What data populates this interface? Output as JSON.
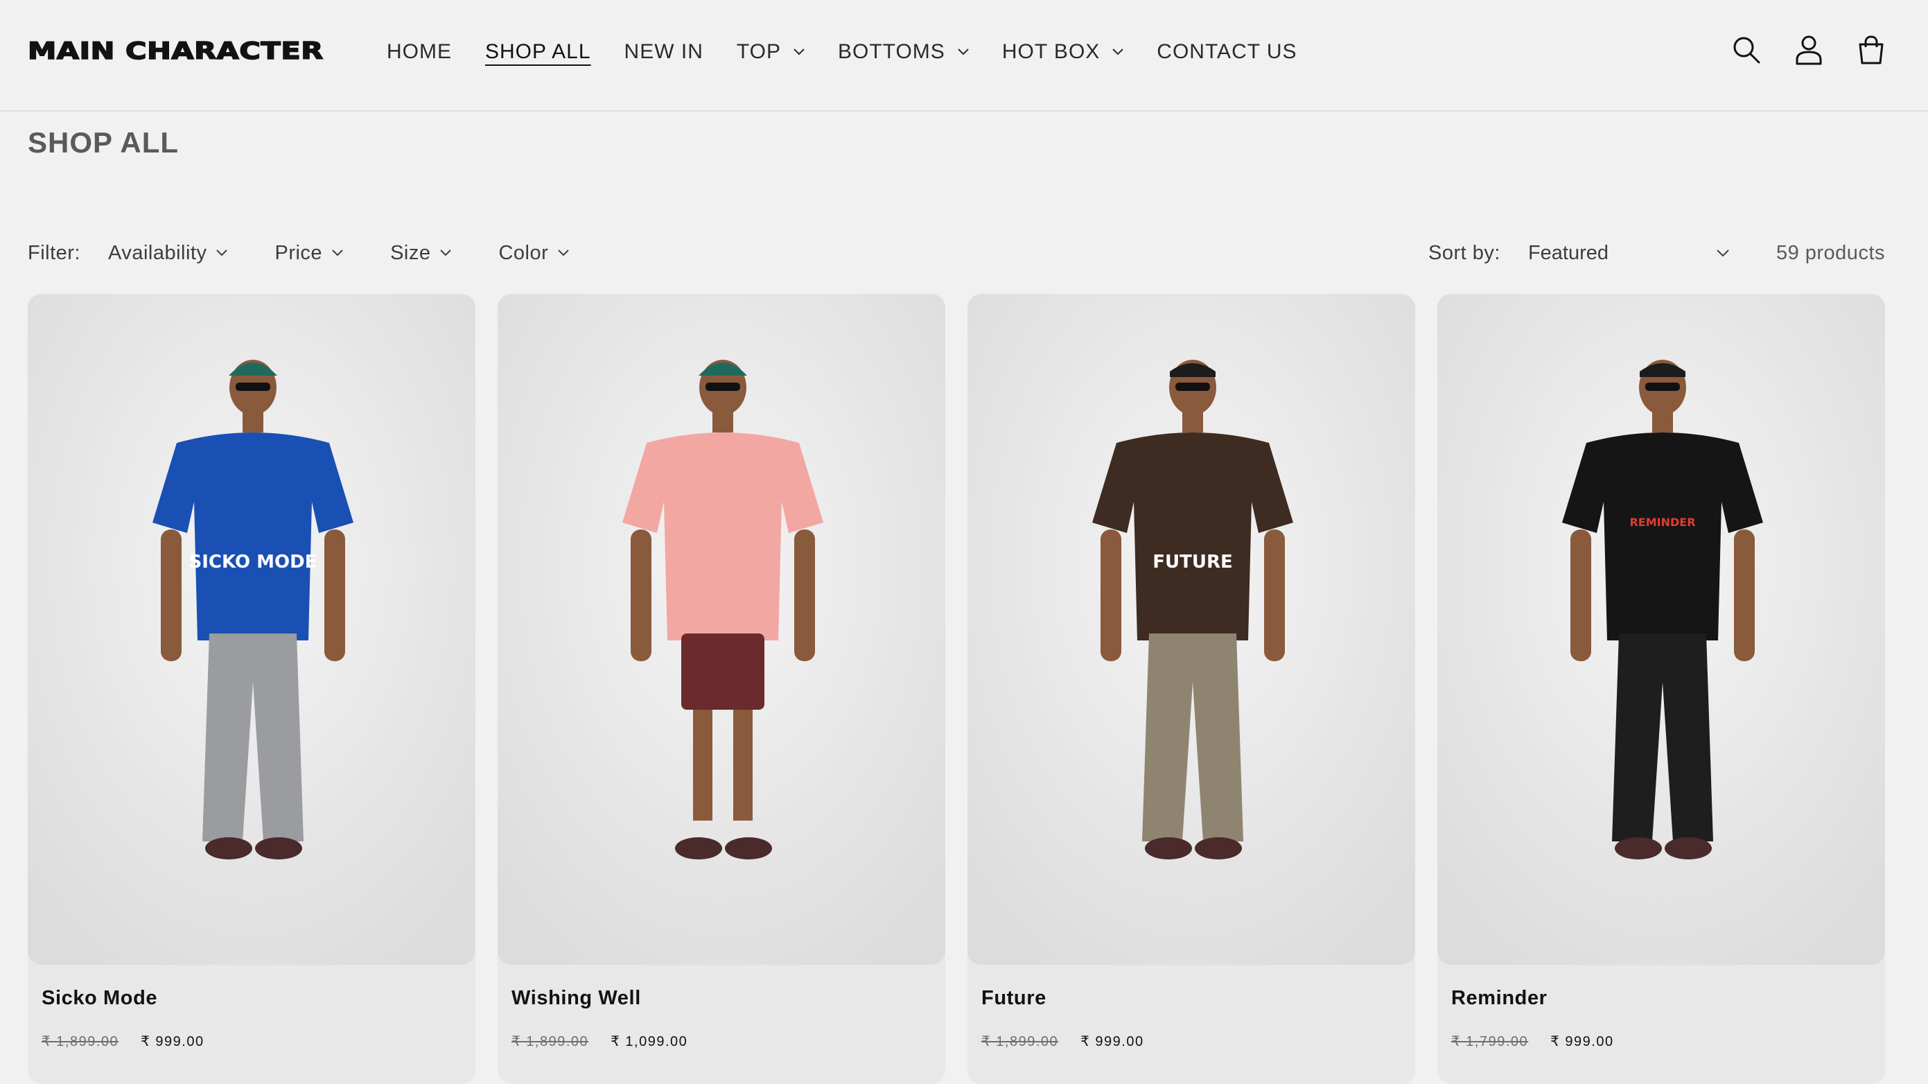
{
  "brand": {
    "logo_text": "MAIN CHARACTER"
  },
  "nav": {
    "items": [
      {
        "label": "HOME",
        "dropdown": false,
        "active": false
      },
      {
        "label": "SHOP ALL",
        "dropdown": false,
        "active": true
      },
      {
        "label": "NEW IN",
        "dropdown": false,
        "active": false
      },
      {
        "label": "TOP",
        "dropdown": true,
        "active": false
      },
      {
        "label": "BOTTOMS",
        "dropdown": true,
        "active": false
      },
      {
        "label": "HOT BOX",
        "dropdown": true,
        "active": false
      },
      {
        "label": "CONTACT US",
        "dropdown": false,
        "active": false
      }
    ]
  },
  "header_icons": [
    "search-icon",
    "account-icon",
    "cart-icon"
  ],
  "page": {
    "title": "SHOP ALL"
  },
  "filters": {
    "label": "Filter:",
    "items": [
      "Availability",
      "Price",
      "Size",
      "Color"
    ]
  },
  "sort": {
    "label": "Sort by:",
    "selected": "Featured"
  },
  "product_count": "59 products",
  "products": [
    {
      "title": "Sicko Mode",
      "price_old": "₹ 1,899.00",
      "price_new": "₹ 999.00",
      "shirt_color": "#1a4fb4",
      "bottom_color": "#9a9ca0",
      "shirt_text": "SICKO MODE"
    },
    {
      "title": "Wishing Well",
      "price_old": "₹ 1,899.00",
      "price_new": "₹ 1,099.00",
      "shirt_color": "#f3a7a3",
      "bottom_color": "#6b2a2c",
      "shirt_text": ""
    },
    {
      "title": "Future",
      "price_old": "₹ 1,899.00",
      "price_new": "₹ 999.00",
      "shirt_color": "#3e2b22",
      "bottom_color": "#8f8470",
      "shirt_text": "FUTURE"
    },
    {
      "title": "Reminder",
      "price_old": "₹ 1,799.00",
      "price_new": "₹ 999.00",
      "shirt_color": "#151515",
      "bottom_color": "#1e1e1e",
      "shirt_text": "REMINDER"
    }
  ]
}
